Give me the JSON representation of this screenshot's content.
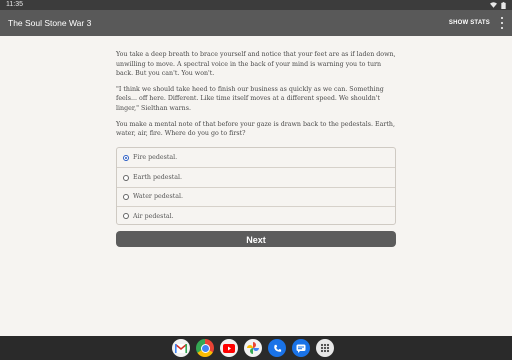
{
  "status": {
    "time": "11:35"
  },
  "appbar": {
    "title": "The Soul Stone War 3",
    "show_stats": "SHOW STATS"
  },
  "story": {
    "paragraphs": [
      "You take a deep breath to brace yourself and notice that your feet are as if laden down, unwilling to move. A spectral voice in the back of your mind is warning you to turn back. But you can't. You won't.",
      "\"I think we should take heed to finish our business as quickly as we can. Something feels... off here. Different. Like time itself moves at a different speed. We shouldn't linger,\" Sielthan warns.",
      "You make a mental note of that before your gaze is drawn back to the pedestals. Earth, water, air, fire. Where do you go to first?"
    ]
  },
  "choices": [
    {
      "label": "Fire pedestal.",
      "selected": true
    },
    {
      "label": "Earth pedestal.",
      "selected": false
    },
    {
      "label": "Water pedestal.",
      "selected": false
    },
    {
      "label": "Air pedestal.",
      "selected": false
    }
  ],
  "next_label": "Next",
  "dock": {
    "apps": [
      "gmail-icon",
      "chrome-icon",
      "youtube-icon",
      "photos-icon",
      "phone-icon",
      "messages-icon",
      "app-drawer-icon"
    ]
  },
  "colors": {
    "appbar": "#595959",
    "background": "#f6f4f1",
    "button": "#5c5c5c",
    "radio_selected": "#2e5fc4"
  }
}
